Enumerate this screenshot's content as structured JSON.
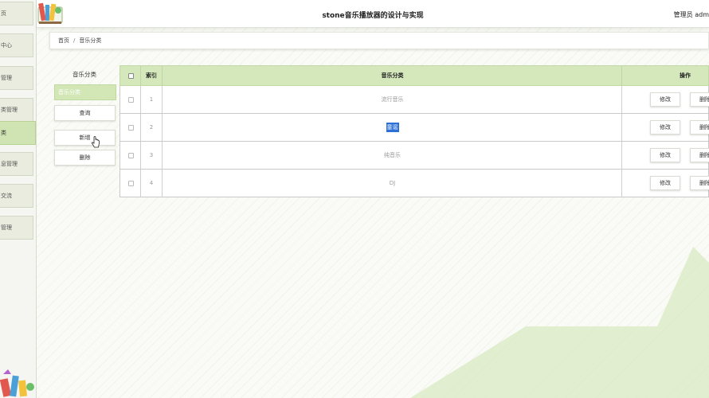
{
  "app": {
    "title": "stone音乐播放器的设计与实现",
    "user": "管理员 adm"
  },
  "sidebar": {
    "items": [
      {
        "label": "页"
      },
      {
        "label": "中心"
      },
      {
        "label": "管理"
      },
      {
        "label": "类管理"
      },
      {
        "label": "类"
      },
      {
        "label": "息管理"
      },
      {
        "label": "交流"
      },
      {
        "label": "管理"
      }
    ]
  },
  "breadcrumb": {
    "home": "首页",
    "separator": "/",
    "current": "音乐分类"
  },
  "left_panel": {
    "title": "音乐分类",
    "search_placeholder": "音乐分类",
    "query_label": "查询",
    "add_label": "新增",
    "delete_label": "删除"
  },
  "table": {
    "headers": {
      "index": "索引",
      "category": "音乐分类",
      "actions": "操作"
    },
    "rows": [
      {
        "index": "1",
        "category": "流行音乐"
      },
      {
        "index": "2",
        "category": "童谣"
      },
      {
        "index": "3",
        "category": "纯音乐"
      },
      {
        "index": "4",
        "category": "DJ"
      }
    ],
    "edit_label": "修改",
    "delete_label": "删除"
  },
  "colors": {
    "accent": "#d5e8bc",
    "accent_dark": "#b7d293",
    "selection": "#2c6fd6"
  }
}
